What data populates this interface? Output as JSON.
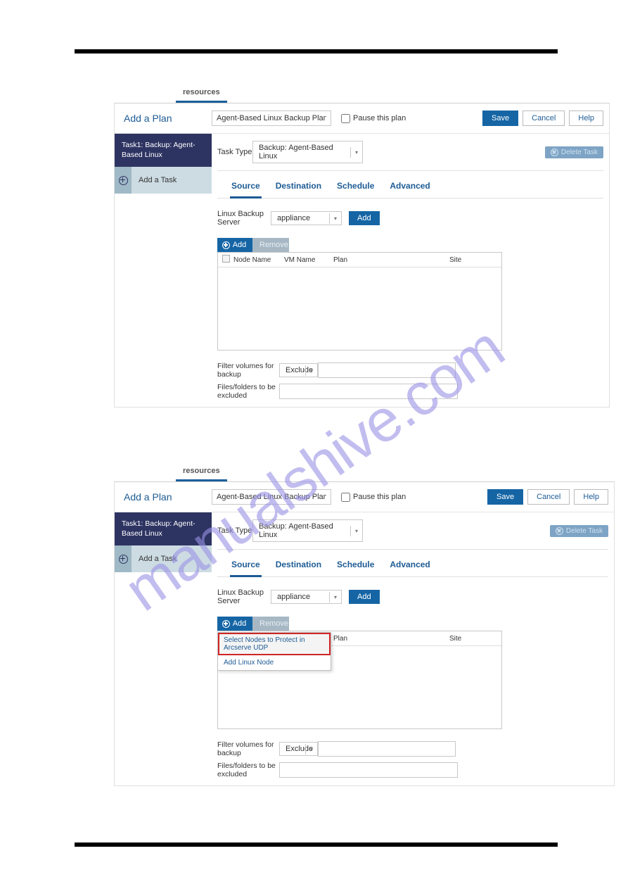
{
  "watermark": "manualshive.com",
  "topTab": "resources",
  "addPlan": {
    "title": "Add a Plan",
    "planName": "Agent-Based Linux Backup Plan",
    "pauseLabel": "Pause this plan",
    "saveLabel": "Save",
    "cancelLabel": "Cancel",
    "helpLabel": "Help"
  },
  "sidebar": {
    "task1": "Task1: Backup: Agent-Based Linux",
    "addTaskLabel": "Add a Task"
  },
  "taskTypeRow": {
    "label": "Task Type",
    "value": "Backup: Agent-Based Linux",
    "deleteLabel": "Delete Task"
  },
  "innerTabs": {
    "source": "Source",
    "destination": "Destination",
    "schedule": "Schedule",
    "advanced": "Advanced"
  },
  "source": {
    "lbsLabel": "Linux Backup Server",
    "lbsValue": "appliance",
    "addServerLabel": "Add",
    "addNodeLabel": "Add",
    "removeLabel": "Remove",
    "gridHeaders": {
      "node": "Node Name",
      "vm": "VM Name",
      "plan": "Plan",
      "site": "Site"
    },
    "filterVolLabel": "Filter volumes for backup",
    "filterVolValue": "Exclude",
    "filesExcludedLabel": "Files/folders to be excluded"
  },
  "addMenu": {
    "item1": "Select Nodes to Protect in Arcserve UDP",
    "item2": "Add Linux Node"
  }
}
